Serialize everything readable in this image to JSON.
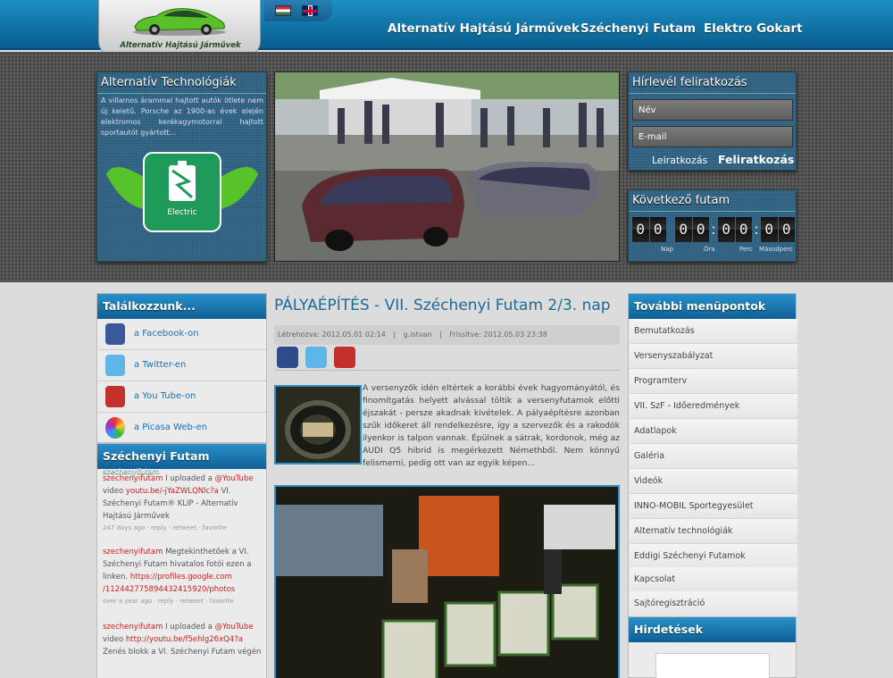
{
  "header": {
    "logo_text": "Alternatív Hajtású Járművek",
    "nav": [
      "Alternatív Hajtású Járművek",
      "Széchenyi Futam",
      "Elektro Gokart"
    ]
  },
  "alt_tech": {
    "title": "Alternatív Technológiák",
    "text": "A villamos árammal hajtott autók ötlete nem új keletű. Porsche az 1900-as évek elején elektromos kerékagymotorral hajtott sportautót gyártott...",
    "badge": "Electric"
  },
  "newsletter": {
    "title": "Hírlevél feliratkozás",
    "name_placeholder": "Név",
    "email_placeholder": "E-mail",
    "unsubscribe": "Leiratkozás",
    "subscribe": "Feliratkozás"
  },
  "next_race": {
    "title": "Következő futam",
    "digits": [
      "0",
      "0",
      "0",
      "0",
      "0",
      "0",
      "0",
      "0"
    ],
    "labels": [
      "Nap",
      "Óra",
      "Perc",
      "Másodperc"
    ]
  },
  "meet": {
    "title": "Találkozzunk...",
    "links": [
      "a Facebook-on",
      "a Twitter-en",
      "a You Tube-on",
      "a Picasa Web-en"
    ]
  },
  "twitter": {
    "title": "Széchenyi Futam",
    "handle": "szechenyifutam",
    "tweets": [
      {
        "user": "szechenyifutam",
        "pre": " I uploaded a ",
        "mention": "@YouTube",
        "mid": " video ",
        "link": "youtu.be/-jYaZWLQNlc?a",
        "post": " VI. Széchenyi Futam® KLIP - Alternatív Hajtású Járművek",
        "meta": "247 days ago · reply · retweet · favorite"
      },
      {
        "user": "szechenyifutam",
        "pre": " Megtekinthetőek a VI. Széchenyi Futam hivatalos fotói ezen a linken. ",
        "mention": "",
        "mid": "",
        "link": "https://profiles.google.com /112442775894432415920/photos",
        "post": "",
        "meta": "over a year ago · reply · retweet · favorite"
      },
      {
        "user": "szechenyifutam",
        "pre": " I uploaded a ",
        "mention": "@YouTube",
        "mid": " video ",
        "link": "http://youtu.be/f5ehlg26xQ4?a",
        "post": " Zenés blokk a VI. Széchenyi Futam végén",
        "meta": ""
      }
    ]
  },
  "article": {
    "title": "PÁLYAÉPÍTÉS - VII. Széchenyi Futam 2/3. nap",
    "created": "Létrehozva: 2012.05.01 02:14",
    "author": "g.istvan",
    "updated": "Frissítve: 2012.05.03 23:38",
    "body": "A versenyzők idén eltértek a korábbi évek hagyományától, és finomítgatás helyett alvással töltik a versenyfutamok előtti éjszakát - persze akadnak kivételek. A pályaépítésre azonban szűk időkeret áll rendelkezésre, így a szervezők és a rakodók ilyenkor is talpon vannak. Épülnek a sátrak, kordonok, még az AUDI Q5 hibrid is megérkezett Németh­ből. Nem könnyű felismerni, pedig ott van az egyik képen..."
  },
  "more_menu": {
    "title": "További menüpontok",
    "items": [
      "Bemutatkozás",
      "Versenyszabályzat",
      "Programterv",
      "VII. SzF - Időeredmények",
      "Adatlapok",
      "Galéria",
      "Videók",
      "INNO-MOBIL Sportegyesület",
      "Alternatív technológiák",
      "Eddigi Széchenyi Futamok",
      "Kapcsolat",
      "Sajtóregisztráció"
    ]
  },
  "ads": {
    "title": "Hirdetések"
  },
  "colors": {
    "accent": "#1d6a9a",
    "header": "#0a5d8f",
    "tweet_user": "#cc2222"
  }
}
